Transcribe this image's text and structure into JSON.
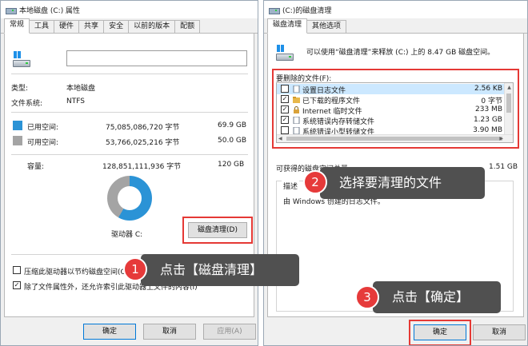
{
  "left_window": {
    "title": "本地磁盘 (C:) 属性",
    "tabs": [
      "常规",
      "工具",
      "硬件",
      "共享",
      "安全",
      "以前的版本",
      "配额"
    ],
    "name_value": "",
    "type_label": "类型:",
    "type_value": "本地磁盘",
    "fs_label": "文件系统:",
    "fs_value": "NTFS",
    "used": {
      "label": "已用空间:",
      "bytes": "75,085,086,720 字节",
      "size": "69.9 GB",
      "color": "#2b93d6"
    },
    "free": {
      "label": "可用空间:",
      "bytes": "53,766,025,216 字节",
      "size": "50.0 GB",
      "color": "#a4a4a4"
    },
    "capacity": {
      "label": "容量:",
      "bytes": "128,851,111,936 字节",
      "size": "120 GB"
    },
    "used_fraction": 0.583,
    "drive_label": "驱动器 C:",
    "cleanup_button": "磁盘清理(D)",
    "compress_label": "压缩此驱动器以节约磁盘空间(C)",
    "index_label": "除了文件属性外，还允许索引此驱动器上文件的内容(I)",
    "buttons": {
      "ok": "确定",
      "cancel": "取消",
      "apply": "应用(A)"
    }
  },
  "right_window": {
    "title": "(C:)的磁盘清理",
    "tabs": [
      "磁盘清理",
      "其他选项"
    ],
    "info_text": "可以使用“磁盘清理”来释放 (C:) 上的 8.47 GB 磁盘空间。",
    "files_label": "要删除的文件(F):",
    "files": [
      {
        "name": "设置日志文件",
        "size": "2.56 KB",
        "checked": false,
        "selected": true,
        "icon": "file-icon"
      },
      {
        "name": "已下载的程序文件",
        "size": "0 字节",
        "checked": true,
        "selected": false,
        "icon": "folder-icon"
      },
      {
        "name": "Internet 临时文件",
        "size": "233 MB",
        "checked": true,
        "selected": false,
        "icon": "lock-icon"
      },
      {
        "name": "系统错误内存转储文件",
        "size": "1.23 GB",
        "checked": true,
        "selected": false,
        "icon": "file-icon"
      },
      {
        "name": "系统错误小型转储文件",
        "size": "3.90 MB",
        "checked": false,
        "selected": false,
        "icon": "file-icon"
      }
    ],
    "total_label": "可获得的磁盘空间总量:",
    "total_value": "1.51 GB",
    "desc_label": "描述",
    "desc_text": "由 Windows 创建的日志文件。",
    "buttons": {
      "ok": "确定",
      "cancel": "取消"
    }
  },
  "callouts": [
    {
      "num": "1",
      "text": "点击【磁盘清理】"
    },
    {
      "num": "2",
      "text": "选择要清理的文件"
    },
    {
      "num": "3",
      "text": "点击【确定】"
    }
  ],
  "colors": {
    "highlight_red": "#e53935",
    "callout_bg": "#505050",
    "badge_red": "#e63a3a"
  }
}
